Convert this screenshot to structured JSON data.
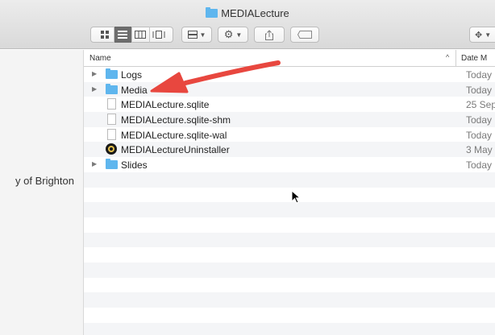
{
  "window": {
    "title": "MEDIALecture"
  },
  "toolbar": {
    "view_buttons": [
      "icon-view",
      "list-view",
      "column-view",
      "gallery-view"
    ],
    "active_view": "list-view"
  },
  "sidebar": {
    "location_label": "y of Brighton"
  },
  "columns": {
    "name": "Name",
    "sort_indicator": "^",
    "date": "Date M"
  },
  "files": [
    {
      "name": "Logs",
      "kind": "folder",
      "date": "Today"
    },
    {
      "name": "Media",
      "kind": "folder",
      "date": "Today"
    },
    {
      "name": "MEDIALecture.sqlite",
      "kind": "document",
      "date": "25 Sep"
    },
    {
      "name": "MEDIALecture.sqlite-shm",
      "kind": "document",
      "date": "Today"
    },
    {
      "name": "MEDIALecture.sqlite-wal",
      "kind": "document",
      "date": "Today"
    },
    {
      "name": "MEDIALectureUninstaller",
      "kind": "app",
      "date": "3 May"
    },
    {
      "name": "Slides",
      "kind": "folder",
      "date": "Today"
    }
  ],
  "colors": {
    "folder": "#5fb6ee",
    "annotation_arrow": "#e8473f",
    "row_stripe": "#f4f5f7"
  }
}
